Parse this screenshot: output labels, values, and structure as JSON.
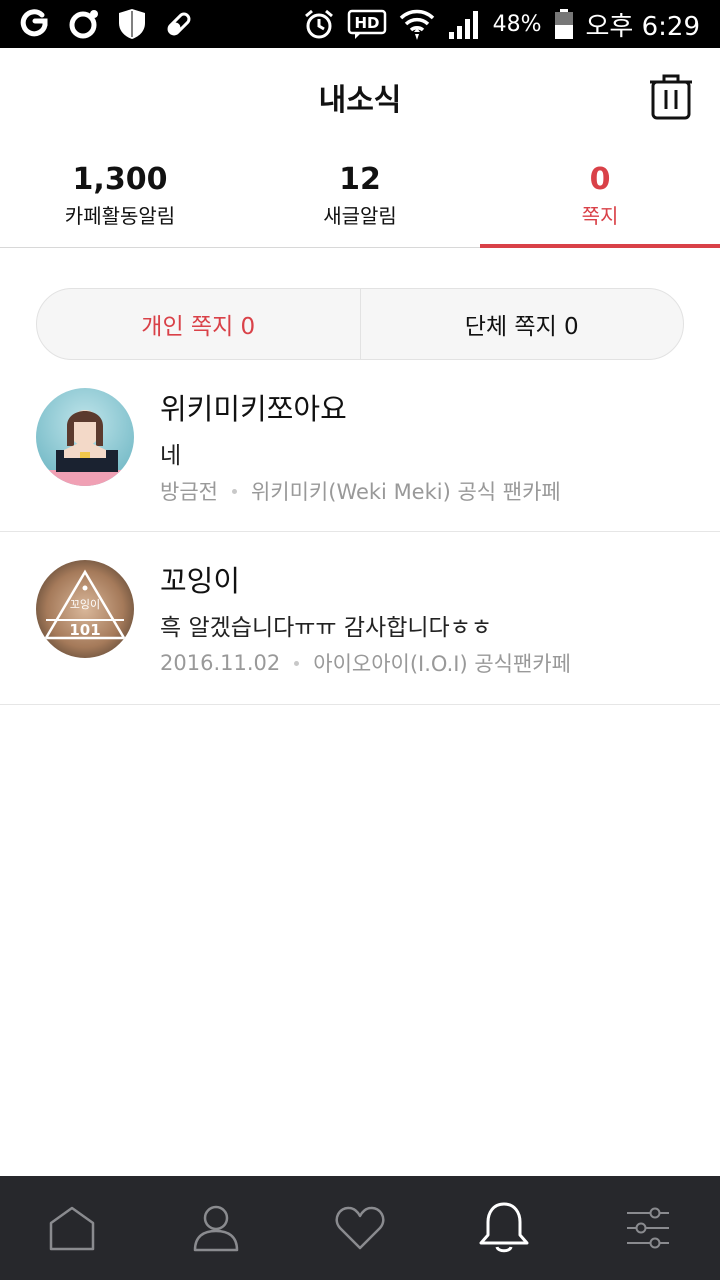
{
  "status_bar": {
    "battery_percent": "48%",
    "time": "오후 6:29"
  },
  "header": {
    "title": "내소식",
    "trash_icon": "trash-icon"
  },
  "tabs": [
    {
      "count": "1,300",
      "label": "카페활동알림",
      "active": false
    },
    {
      "count": "12",
      "label": "새글알림",
      "active": false
    },
    {
      "count": "0",
      "label": "쪽지",
      "active": true
    }
  ],
  "segment": {
    "personal": "개인 쪽지 0",
    "group": "단체 쪽지 0"
  },
  "messages": [
    {
      "sender": "위키미키쪼아요",
      "body": "네",
      "time": "방금전",
      "cafe": "위키미키(Weki Meki) 공식 팬카페"
    },
    {
      "sender": "꼬잉이",
      "body": "흑 알겠습니다ㅠㅠ 감사합니다ㅎㅎ",
      "time": "2016.11.02",
      "cafe": "아이오아이(I.O.I) 공식팬카페",
      "avatar_text_top": "꼬잉이",
      "avatar_text_bottom": "101"
    }
  ],
  "bottom_nav": [
    "home-icon",
    "profile-icon",
    "heart-icon",
    "bell-icon",
    "settings-sliders-icon"
  ],
  "colors": {
    "accent": "#d94148",
    "nav_bg": "#27282c"
  }
}
